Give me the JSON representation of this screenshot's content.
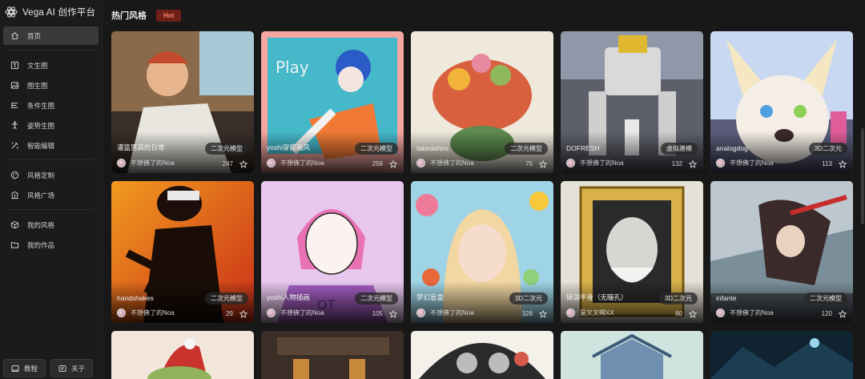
{
  "app": {
    "title": "Vega AI 创作平台"
  },
  "sidebar": {
    "items": [
      {
        "label": "首页",
        "icon": "home-icon"
      },
      {
        "label": "文生图",
        "icon": "text-image-icon"
      },
      {
        "label": "图生图",
        "icon": "image-icon"
      },
      {
        "label": "条件生图",
        "icon": "sliders-icon"
      },
      {
        "label": "姿势生图",
        "icon": "pose-icon"
      },
      {
        "label": "智能编辑",
        "icon": "magic-edit-icon"
      },
      {
        "label": "风格定制",
        "icon": "palette-icon"
      },
      {
        "label": "风格广场",
        "icon": "plaza-icon"
      },
      {
        "label": "我的风格",
        "icon": "box-icon"
      },
      {
        "label": "我的作品",
        "icon": "folder-icon"
      }
    ],
    "bottom": {
      "tutorial": "教程",
      "about": "关于"
    }
  },
  "section": {
    "title": "热门风格",
    "badge": "Hot"
  },
  "cards": [
    {
      "title": "灌篮男高的日常",
      "tag": "二次元模型",
      "author": "不想佛了的Noa",
      "likes": "247"
    },
    {
      "title": "yoshi穿搭画风",
      "tag": "二次元模型",
      "author": "不想佛了的Noa",
      "likes": "256"
    },
    {
      "title": "takedahiro",
      "tag": "二次元模型",
      "author": "不想佛了的Noa",
      "likes": "75"
    },
    {
      "title": "DOFRESH",
      "tag": "虚拟建模",
      "author": "不想佛了的Noa",
      "likes": "132"
    },
    {
      "title": "analogdog",
      "tag": "3D二次元",
      "author": "不想佛了的Noa",
      "likes": "113"
    },
    {
      "title": "handshakes",
      "tag": "二次元模型",
      "author": "不想佛了的Noa",
      "likes": "29"
    },
    {
      "title": "yoshi人物插画",
      "tag": "二次元模型",
      "author": "不想佛了的Noa",
      "likes": "105"
    },
    {
      "title": "梦幻盲盒",
      "tag": "3D二次元",
      "author": "不想佛了的Noa",
      "likes": "328"
    },
    {
      "title": "铸湖半身（无瞳孔）",
      "tag": "3D二次元",
      "author": "是叉叉啊XX",
      "likes": "80"
    },
    {
      "title": "infante",
      "tag": "二次元模型",
      "author": "不想佛了的Noa",
      "likes": "120"
    }
  ],
  "colors": {
    "background": "#181818",
    "sidebar": "#1b1b1b",
    "active": "#3a3a3a",
    "hot_badge": "#6e2018"
  }
}
